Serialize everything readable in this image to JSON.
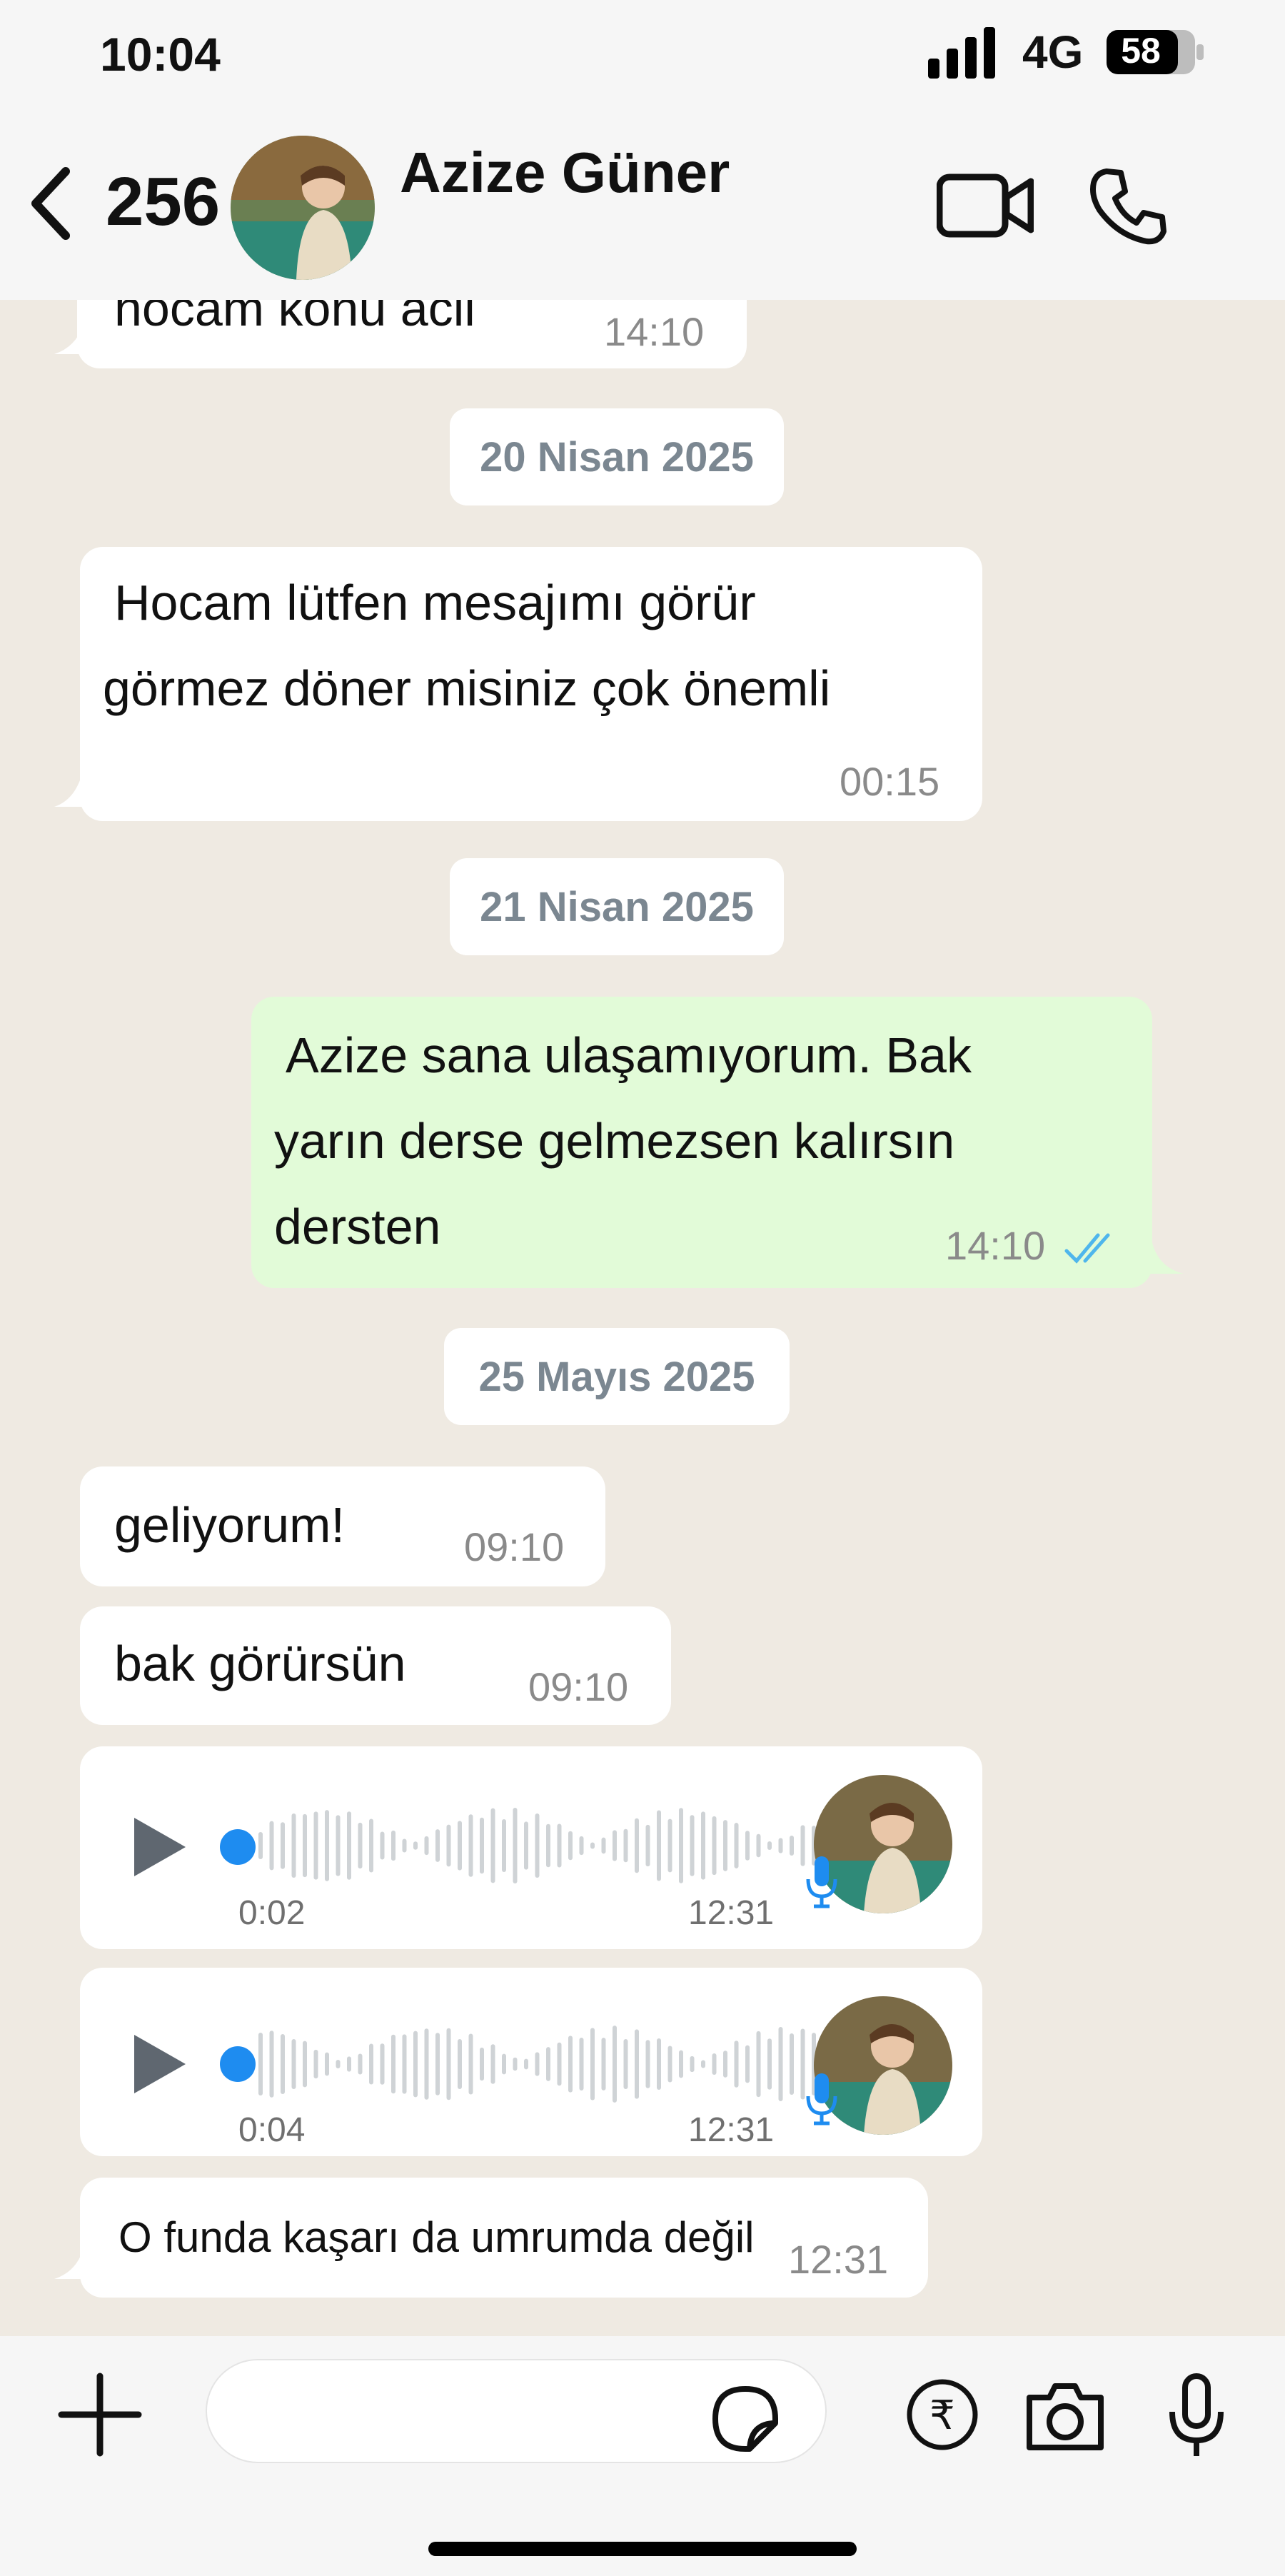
{
  "status_bar": {
    "time": "10:04",
    "network": "4G",
    "battery": "58"
  },
  "header": {
    "back_count": "256",
    "contact_name": "Azize Güner"
  },
  "messages": [
    {
      "type": "in",
      "text": "hocam konu acil",
      "time": "14:10"
    },
    {
      "type": "date",
      "text": "20 Nisan 2025"
    },
    {
      "type": "in",
      "lines": [
        "Hocam lütfen mesajımı görür",
        "görmez döner misiniz çok önemli"
      ],
      "time": "00:15"
    },
    {
      "type": "date",
      "text": "21 Nisan 2025"
    },
    {
      "type": "out",
      "lines": [
        "Azize sana ulaşamıyorum. Bak",
        "yarın derse gelmezsen kalırsın",
        "dersten"
      ],
      "time": "14:10"
    },
    {
      "type": "date",
      "text": "25 Mayıs 2025"
    },
    {
      "type": "in",
      "text": "geliyorum!",
      "time": "09:10"
    },
    {
      "type": "in",
      "text": "bak görürsün",
      "time": "09:10"
    },
    {
      "type": "voice",
      "duration": "0:02",
      "time": "12:31"
    },
    {
      "type": "voice",
      "duration": "0:04",
      "time": "12:31"
    },
    {
      "type": "in",
      "text": "O funda kaşarı da umrumda değil",
      "time": "12:31"
    }
  ],
  "colors": {
    "outgoing_bubble": "#e2fbd8",
    "chat_background": "#efeae2",
    "read_ticks": "#4fb6ec",
    "voice_dot": "#1e8cf0"
  },
  "icons": [
    "back-chevron-icon",
    "video-call-icon",
    "phone-icon",
    "plus-icon",
    "sticker-icon",
    "rupee-icon",
    "camera-icon",
    "microphone-icon"
  ]
}
